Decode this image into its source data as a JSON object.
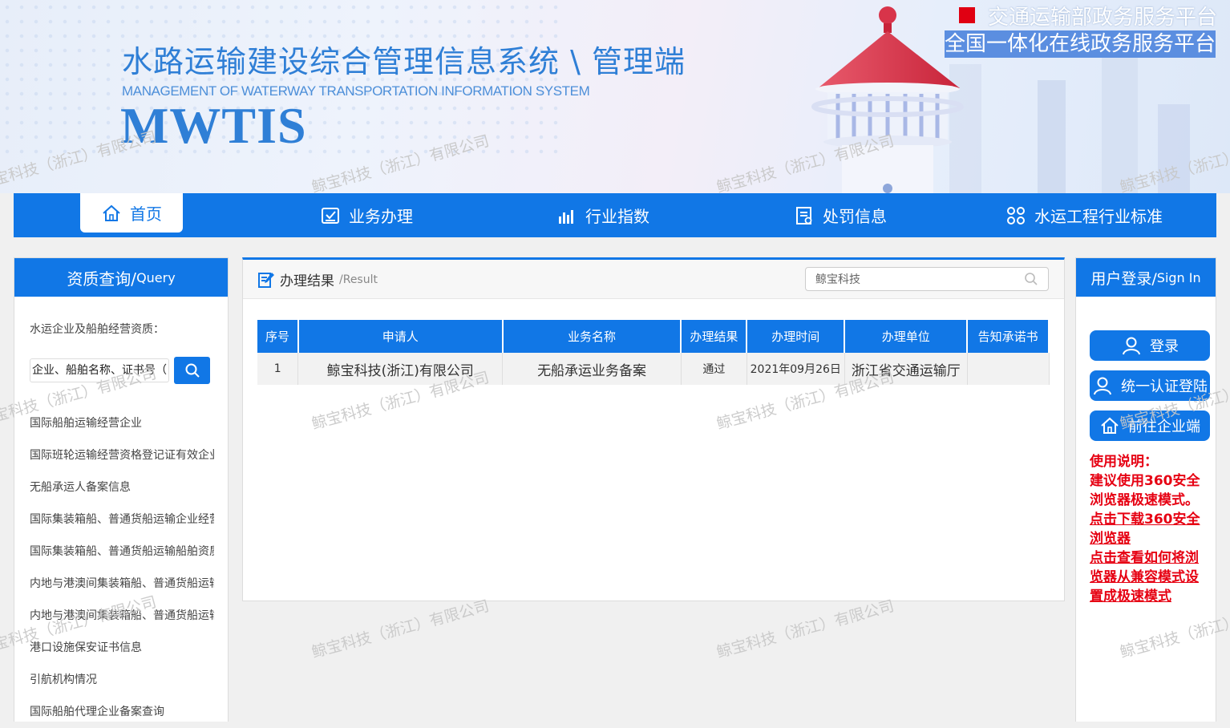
{
  "header": {
    "title_cn": "水路运输建设综合管理信息系统 \\ 管理端",
    "title_en": "MANAGEMENT OF WATERWAY TRANSPORTATION INFORMATION SYSTEM",
    "abbr": "MWTIS",
    "gov_platform": "交通运输部政务服务平台",
    "gov_subplatform": "全国一体化在线政务服务平台"
  },
  "nav": {
    "items": [
      {
        "label": "首页",
        "icon": "home-icon"
      },
      {
        "label": "业务办理",
        "icon": "checklist-icon"
      },
      {
        "label": "行业指数",
        "icon": "bar-chart-icon"
      },
      {
        "label": "处罚信息",
        "icon": "document-icon"
      },
      {
        "label": "水运工程行业标准",
        "icon": "grid-icon"
      }
    ]
  },
  "left_panel": {
    "title": "资质查询/",
    "title_sub": "Query",
    "intro": "水运企业及船舶经营资质：",
    "search_placeholder": "企业、船舶名称、证书号（",
    "items": [
      "国际船舶运输经营企业",
      "国际班轮运输经营资格登记证有效企业",
      "无船承运人备案信息",
      "国际集装箱船、普通货船运输企业经营资质",
      "国际集装箱船、普通货船运输船舶资质",
      "内地与港澳间集装箱船、普通货船运输企业",
      "内地与港澳间集装箱船、普通货船运输船舶",
      "港口设施保安证书信息",
      "引航机构情况",
      "国际船舶代理企业备案查询"
    ]
  },
  "main": {
    "title": "办理结果",
    "title_sub": "/Result",
    "search_value": "鲸宝科技",
    "table": {
      "headers": [
        "序号",
        "申请人",
        "业务名称",
        "办理结果",
        "办理时间",
        "办理单位",
        "告知承诺书"
      ],
      "rows": [
        [
          "1",
          "鲸宝科技(浙江)有限公司",
          "无船承运业务备案",
          "通过",
          "2021年09月26日",
          "浙江省交通运输厅",
          ""
        ]
      ]
    }
  },
  "right_panel": {
    "title": "用户登录/",
    "title_sub": "Sign In",
    "login_label": "登录",
    "unified_login_label": "统一认证登陆",
    "enterprise_label": "前往企业端",
    "notes_title": "使用说明：",
    "notes_text": "建议使用360安全浏览器极速模式。",
    "download_link": "点击下载360安全浏览器",
    "howto_link": "点击查看如何将浏览器从兼容模式设置成极速模式"
  },
  "watermark": "鲸宝科技（浙江）有限公司",
  "colors": {
    "primary": "#1177e6",
    "notice_red": "#e60012",
    "gov_red": "#e00012"
  }
}
